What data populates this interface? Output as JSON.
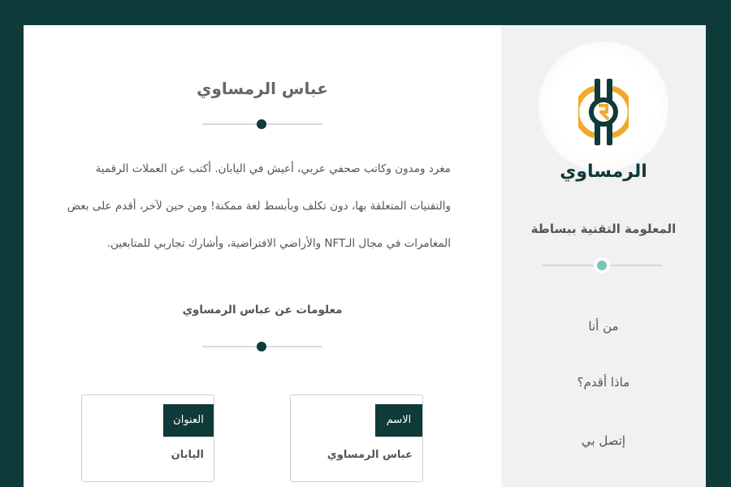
{
  "sidebar": {
    "logo_text": "الرمساوي",
    "tagline": "المعلومة التقنية ببساطة",
    "nav": [
      {
        "label": "من أنا"
      },
      {
        "label": "ماذا أقدم؟"
      },
      {
        "label": "إتصل بي"
      }
    ]
  },
  "main": {
    "title": "عباس الرمساوي",
    "bio": "مغرد ومدون وكاتب صحفي عربي، أعيش في اليابان. أكتب عن العملات الرقمية والتقنيات المتعلقة بها، دون تكلف وبأبسط لغة ممكنة! ومن حين لآخر، أقدم على بعض المغامرات في مجال الـNFT والأراضي الافتراضية، وأشارك تجاربي للمتابعين.",
    "info_title": "معلومات عن عباس الرمساوي",
    "info": [
      {
        "label": "الاسم",
        "value": "عباس الرمساوي"
      },
      {
        "label": "العنوان",
        "value": "اليابان"
      }
    ]
  },
  "colors": {
    "brand_dark": "#0e3a39",
    "accent_gold": "#f0a92b",
    "accent_teal": "#79c6b9"
  }
}
